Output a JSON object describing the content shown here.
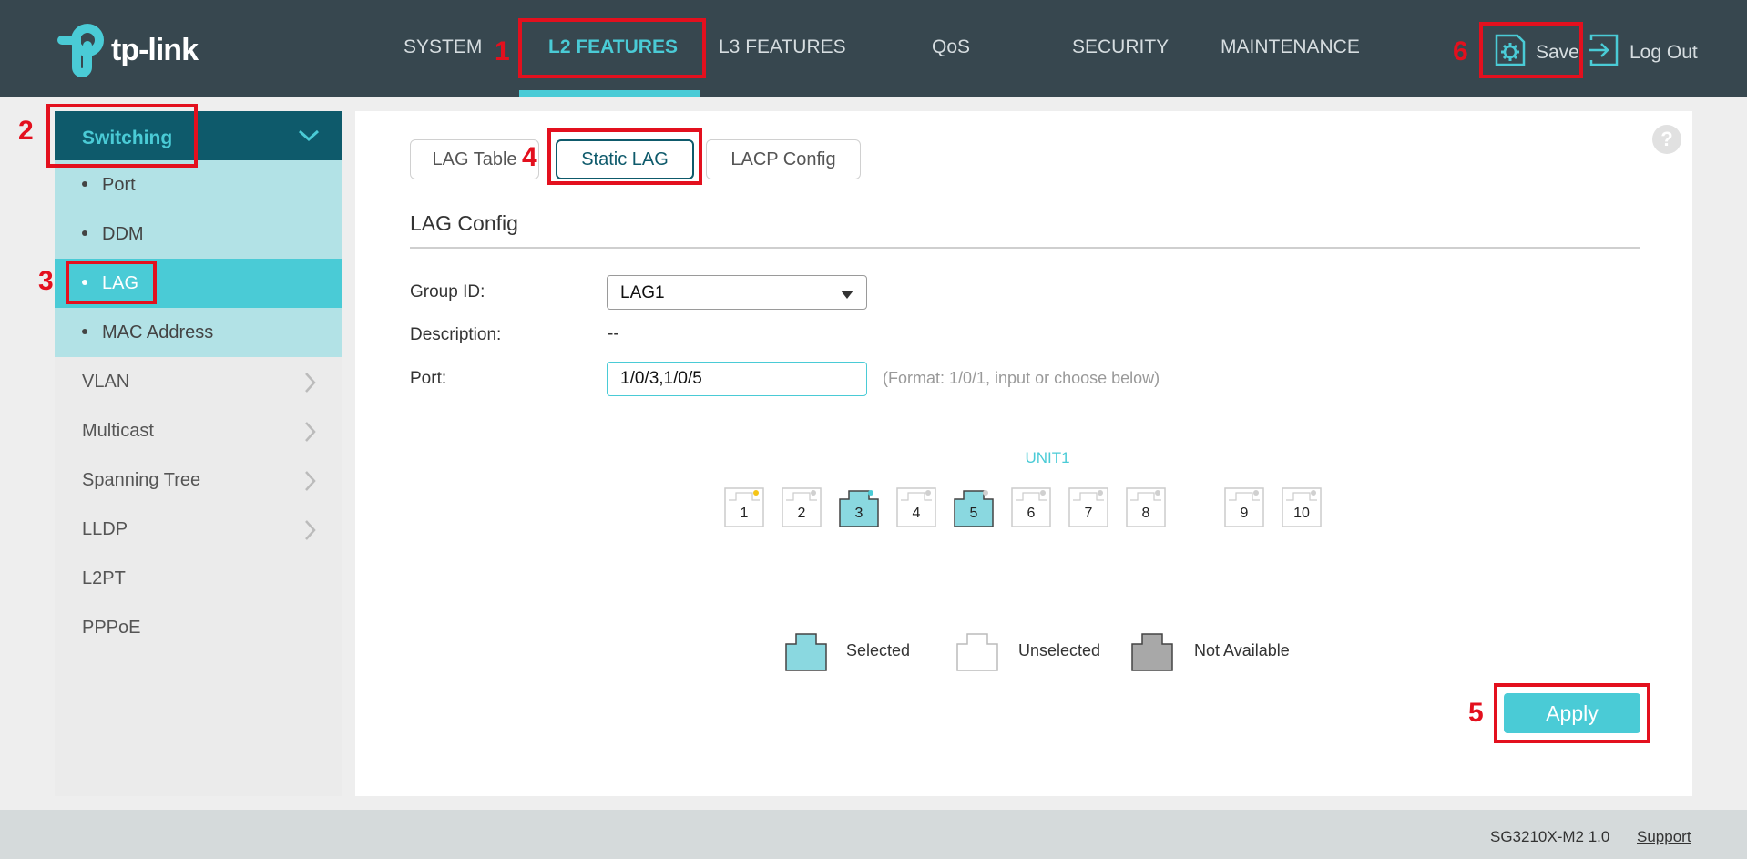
{
  "header": {
    "logo_text": "tp-link",
    "nav": [
      "SYSTEM",
      "L2 FEATURES",
      "L3 FEATURES",
      "QoS",
      "SECURITY",
      "MAINTENANCE"
    ],
    "save_label": "Save",
    "logout_label": "Log Out"
  },
  "sidebar": {
    "group": "Switching",
    "sub_items": [
      "Port",
      "DDM",
      "LAG",
      "MAC Address"
    ],
    "items": [
      "VLAN",
      "Multicast",
      "Spanning Tree",
      "LLDP",
      "L2PT",
      "PPPoE"
    ]
  },
  "tabs": [
    "LAG Table",
    "Static LAG",
    "LACP Config"
  ],
  "section_title": "LAG Config",
  "form": {
    "group_id_label": "Group ID:",
    "group_id_value": "LAG1",
    "description_label": "Description:",
    "description_value": "--",
    "port_label": "Port:",
    "port_value": "1/0/3,1/0/5",
    "port_hint": "(Format: 1/0/1, input or choose below)"
  },
  "unit_label": "UNIT1",
  "ports": [
    {
      "num": "1",
      "selected": false,
      "led": "#f5c518"
    },
    {
      "num": "2",
      "selected": false,
      "led": "#d0d0d0"
    },
    {
      "num": "3",
      "selected": true,
      "led": "#4acbd6"
    },
    {
      "num": "4",
      "selected": false,
      "led": "#d0d0d0"
    },
    {
      "num": "5",
      "selected": true,
      "led": "#d0d0d0"
    },
    {
      "num": "6",
      "selected": false,
      "led": "#d0d0d0"
    },
    {
      "num": "7",
      "selected": false,
      "led": "#d0d0d0"
    },
    {
      "num": "8",
      "selected": false,
      "led": "#d0d0d0"
    },
    {
      "num": "9",
      "selected": false,
      "led": "#d0d0d0"
    },
    {
      "num": "10",
      "selected": false,
      "led": "#d0d0d0"
    }
  ],
  "legend": [
    "Selected",
    "Unselected",
    "Not Available"
  ],
  "apply_label": "Apply",
  "footer": {
    "model": "SG3210X-M2 1.0",
    "support": "Support"
  },
  "annotations": [
    "1",
    "2",
    "3",
    "4",
    "5",
    "6"
  ],
  "colors": {
    "accent": "#4acbd6",
    "header": "#37474f",
    "dark_teal": "#0e5a6b",
    "annotation": "#e3101e"
  }
}
